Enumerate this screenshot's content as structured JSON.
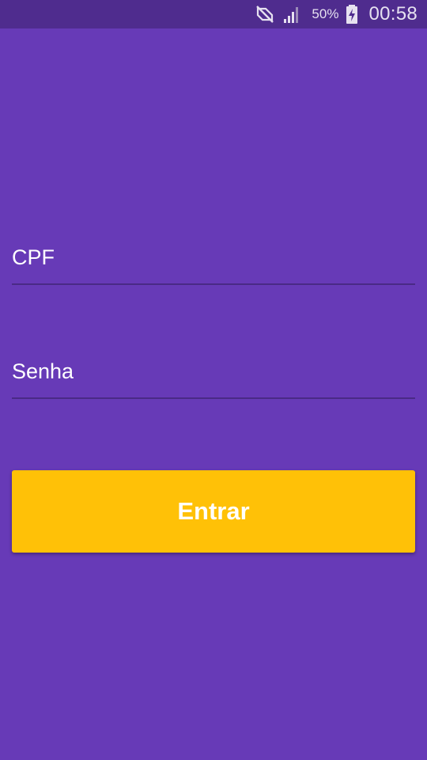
{
  "status_bar": {
    "battery_percent": "50%",
    "time": "00:58",
    "icons": [
      "muted-icon",
      "signal-icon",
      "battery-charging-icon"
    ]
  },
  "form": {
    "cpf_placeholder": "CPF",
    "senha_placeholder": "Senha",
    "submit_label": "Entrar"
  },
  "colors": {
    "background": "#673AB7",
    "status_bar": "#4F2C8E",
    "accent_button": "#FFC107",
    "text": "#FFFFFF"
  }
}
